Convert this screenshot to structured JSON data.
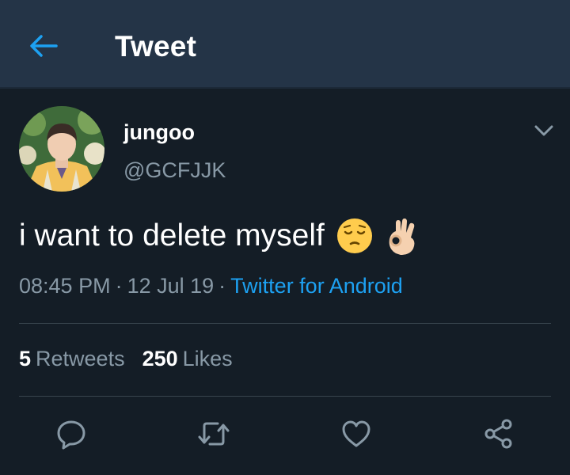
{
  "topbar": {
    "title": "Tweet",
    "back_icon": "arrow-left-icon"
  },
  "tweet": {
    "display_name": "jungoo",
    "handle": "@GCFJJK",
    "text": "i want to delete myself",
    "emojis": [
      "pensive-face-emoji",
      "ok-hand-emoji"
    ],
    "time": "08:45 PM",
    "date": "12 Jul 19",
    "separator": "·",
    "source": "Twitter for Android",
    "retweets_count": "5",
    "retweets_label": "Retweets",
    "likes_count": "250",
    "likes_label": "Likes"
  },
  "actions": [
    "reply-icon",
    "retweet-icon",
    "like-icon",
    "share-icon"
  ],
  "colors": {
    "background": "#141d26",
    "header": "#243447",
    "accent": "#1da1f2",
    "muted": "#8899a6",
    "text": "#ffffff",
    "divider": "#38444d"
  }
}
